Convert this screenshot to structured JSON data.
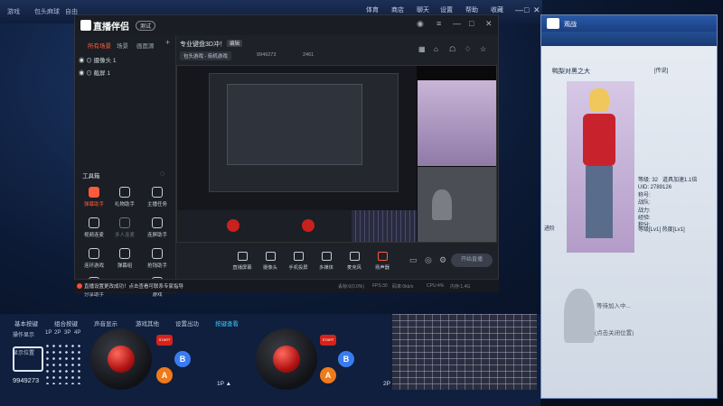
{
  "outer": {
    "tabs": [
      "游戏",
      "包头麻球",
      "自由"
    ],
    "menu": [
      "体育",
      "商店",
      "聊天",
      "设置",
      "帮助",
      "收藏"
    ],
    "window_controls": [
      "—",
      "□",
      "✕"
    ]
  },
  "app": {
    "name": "直播伴侣",
    "version": "测试",
    "title_controls": [
      "≡",
      "—",
      "□",
      "✕"
    ],
    "sidebar_tabs": [
      "所有场景",
      "场景",
      "画面源"
    ],
    "add_icon": "+",
    "scenes": [
      "◉  ⊙ 摄像头 1",
      "◉  ⊙ 截屏 1"
    ],
    "tools_header": "工具箱",
    "tools": [
      {
        "label": "弹幕助手",
        "hot": true
      },
      {
        "label": "礼物助手",
        "hot": false
      },
      {
        "label": "主播任务",
        "hot": false
      },
      {
        "label": "视频连麦",
        "hot": false
      },
      {
        "label": "多人连麦",
        "hot": false,
        "dim": true
      },
      {
        "label": "连屏助手",
        "hot": false
      },
      {
        "label": "连环游戏",
        "hot": false
      },
      {
        "label": "弹幕组",
        "hot": false
      },
      {
        "label": "抢钱助手",
        "hot": false
      },
      {
        "label": "分享助手",
        "hot": false
      },
      {
        "label": "游戏",
        "hot": false
      }
    ],
    "room_title": "专业键盘3D冲！",
    "edit_label": "编辑",
    "category": "包头游戏 - 街机游戏",
    "room_id": "9949273",
    "heat": "2461",
    "right_icons": [
      "▦",
      "⌂",
      "☖",
      "♢",
      "☆",
      "⟲"
    ],
    "bottom_tools": [
      "直播屏幕",
      "摄像头",
      "手机投屏",
      "多媒体",
      "麦克风",
      "扬声器"
    ],
    "live_button": "开始直播",
    "notice": "直播设置更改成功！点击查看可联系专家指导",
    "stats": [
      "丢帧:0(0.0%)",
      "FPS:30",
      "码率:0kb/s",
      "CPU:4%",
      "内存:1.4G"
    ]
  },
  "spectator": {
    "header_label": "观战",
    "p1_name": "鸭梨对黑之大",
    "p1_rank": "[传说]",
    "stats_text": "等级: 32   道具加速1.1倍\nUID: 2789126\n称号:\n战队:\n战力:\n经验:\n积分:",
    "fav_label": "进阶",
    "status_rows": "等级[Lv1]   热度[Lv1]",
    "p2_wait": "等待加入中...",
    "p2_close": "(点击关闭位置)"
  },
  "control_bar": {
    "tabs": [
      "基本按键",
      "组合按键",
      "声音显示",
      "游戏其他",
      "设置出功",
      "按键查看"
    ],
    "active_tab_index": 5,
    "sub_label": "操作显示",
    "players": [
      "1P",
      "2P",
      "3P",
      "4P"
    ],
    "display_label": "显示位置",
    "p1_tag": "1P ▲",
    "p2_tag": "2P",
    "start_label": "START",
    "a_label": "A",
    "b_label": "B",
    "watermark_id": "9949273"
  }
}
